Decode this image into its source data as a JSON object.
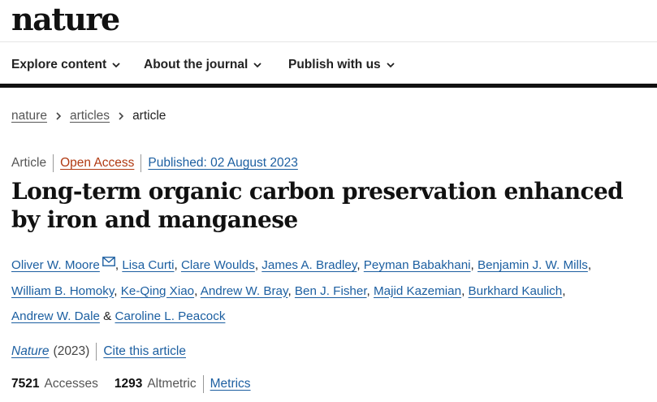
{
  "site": {
    "logo": "nature"
  },
  "nav": {
    "items": [
      {
        "label": "Explore content"
      },
      {
        "label": "About the journal"
      },
      {
        "label": "Publish with us"
      }
    ]
  },
  "breadcrumb": {
    "home": "nature",
    "section": "articles",
    "current": "article"
  },
  "meta": {
    "type": "Article",
    "access": "Open Access",
    "published": "Published: 02 August 2023"
  },
  "title": "Long-term organic carbon preservation enhanced by iron and manganese",
  "authors": [
    "Oliver W. Moore",
    "Lisa Curti",
    "Clare Woulds",
    "James A. Bradley",
    "Peyman Babakhani",
    "Benjamin J. W. Mills",
    "William B. Homoky",
    "Ke-Qing Xiao",
    "Andrew W. Bray",
    "Ben J. Fisher",
    "Majid Kazemian",
    "Burkhard Kaulich",
    "Andrew W. Dale",
    "Caroline L. Peacock"
  ],
  "authors_separator": "&",
  "journal": {
    "name": "Nature",
    "year": "(2023)",
    "cite_label": "Cite this article"
  },
  "metrics": {
    "accesses_value": "7521",
    "accesses_label": "Accesses",
    "altmetric_value": "1293",
    "altmetric_label": "Altmetric",
    "metrics_link": "Metrics"
  },
  "colors": {
    "link": "#1c5fa1",
    "open_access": "#b13a12",
    "rule": "#111111"
  }
}
